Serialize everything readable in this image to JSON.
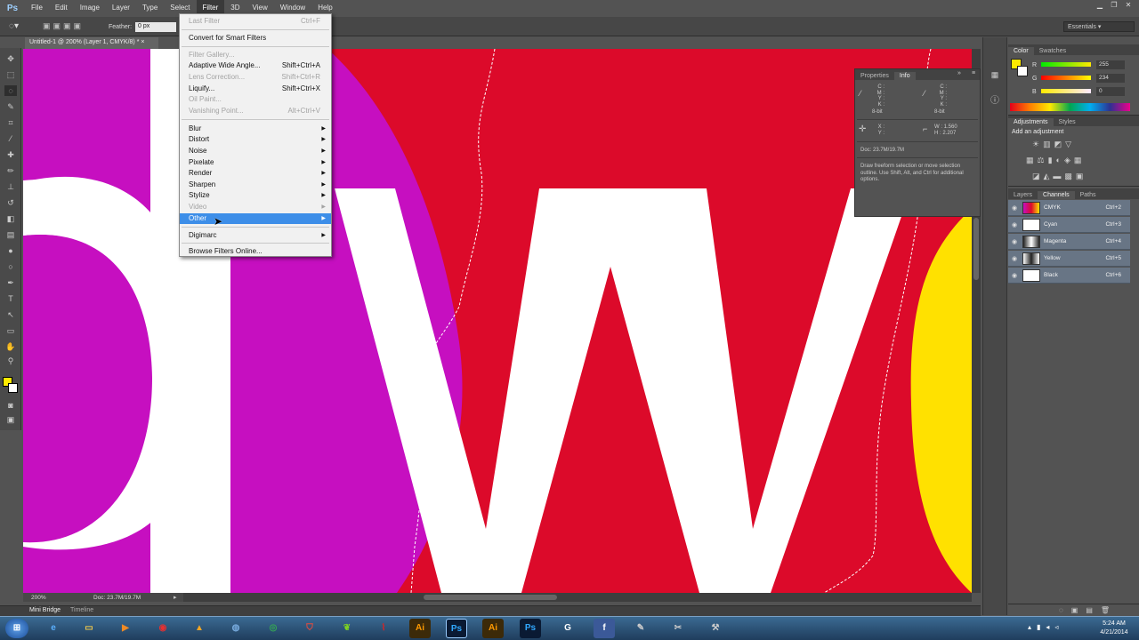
{
  "app": {
    "logo": "Ps"
  },
  "menubar": {
    "items": [
      "File",
      "Edit",
      "Image",
      "Layer",
      "Type",
      "Select",
      "Filter",
      "3D",
      "View",
      "Window",
      "Help"
    ],
    "active": "Filter"
  },
  "options": {
    "feather_label": "Feather:",
    "feather_value": "0 px",
    "workspace": "Essentials"
  },
  "document": {
    "tab_title": "Untitled-1 @ 200% (Layer 1, CMYK/8) *",
    "zoom": "200%",
    "doc_size": "Doc: 23.7M/19.7M"
  },
  "filter_menu": {
    "last_filter": {
      "label": "Last Filter",
      "shortcut": "Ctrl+F"
    },
    "convert": "Convert for Smart Filters",
    "gallery": "Filter Gallery...",
    "adaptive": {
      "label": "Adaptive Wide Angle...",
      "shortcut": "Shift+Ctrl+A"
    },
    "lens": {
      "label": "Lens Correction...",
      "shortcut": "Shift+Ctrl+R"
    },
    "liquify": {
      "label": "Liquify...",
      "shortcut": "Shift+Ctrl+X"
    },
    "oil": "Oil Paint...",
    "vanishing": {
      "label": "Vanishing Point...",
      "shortcut": "Alt+Ctrl+V"
    },
    "submenus": [
      "Blur",
      "Distort",
      "Noise",
      "Pixelate",
      "Render",
      "Sharpen",
      "Stylize",
      "Video",
      "Other"
    ],
    "digimarc": "Digimarc",
    "browse": "Browse Filters Online..."
  },
  "info_panel": {
    "tabs": [
      "Properties",
      "Info"
    ],
    "c_label": "C :",
    "m_label": "M :",
    "y_label": "Y :",
    "k_label": "K :",
    "bit": "8-bit",
    "x_label": "X :",
    "y2_label": "Y :",
    "w_label": "W :",
    "h_label": "H :",
    "w_value": "1.560",
    "h_value": "2.207",
    "doc": "Doc: 23.7M/19.7M",
    "hint": "Draw freeform selection or move selection outline. Use Shift, Alt, and Ctrl for additional options."
  },
  "color_panel": {
    "tabs": [
      "Color",
      "Swatches"
    ],
    "r_label": "R",
    "g_label": "G",
    "b_label": "B",
    "r": "255",
    "g": "234",
    "b": "0",
    "fg_color": "#ffea00"
  },
  "adjustments": {
    "tabs": [
      "Adjustments",
      "Styles"
    ],
    "title": "Add an adjustment"
  },
  "layers_panel": {
    "tabs": [
      "Layers",
      "Channels",
      "Paths"
    ],
    "channels": [
      {
        "name": "CMYK",
        "shortcut": "Ctrl+2"
      },
      {
        "name": "Cyan",
        "shortcut": "Ctrl+3"
      },
      {
        "name": "Magenta",
        "shortcut": "Ctrl+4"
      },
      {
        "name": "Yellow",
        "shortcut": "Ctrl+5"
      },
      {
        "name": "Black",
        "shortcut": "Ctrl+6"
      }
    ]
  },
  "bottom": {
    "mini_bridge": "Mini Bridge",
    "timeline": "Timeline"
  },
  "taskbar": {
    "time": "5:24 AM",
    "date": "4/21/2014"
  }
}
